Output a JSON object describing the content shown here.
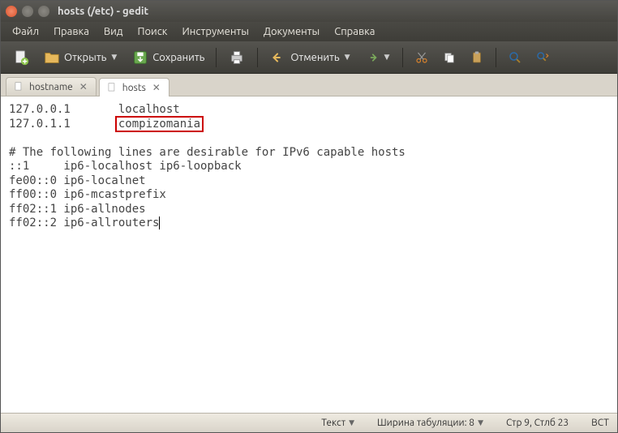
{
  "window": {
    "title": "hosts (/etc) - gedit"
  },
  "menu": {
    "file": "Файл",
    "edit": "Правка",
    "view": "Вид",
    "search": "Поиск",
    "tools": "Инструменты",
    "documents": "Документы",
    "help": "Справка"
  },
  "toolbar": {
    "open": "Открыть",
    "save": "Сохранить",
    "undo": "Отменить"
  },
  "tabs": [
    {
      "label": "hostname",
      "active": false
    },
    {
      "label": "hosts",
      "active": true
    }
  ],
  "editor": {
    "lines": [
      "127.0.0.1       localhost",
      "127.0.1.1       compizomania",
      "",
      "# The following lines are desirable for IPv6 capable hosts",
      "::1     ip6-localhost ip6-loopback",
      "fe00::0 ip6-localnet",
      "ff00::0 ip6-mcastprefix",
      "ff02::1 ip6-allnodes",
      "ff02::2 ip6-allrouters"
    ],
    "highlight": {
      "line": 1,
      "col_start": 16,
      "text": "compizomania"
    }
  },
  "status": {
    "syntax_label": "Текст",
    "tab_label": "Ширина табуляции: 8",
    "cursor": "Стр 9, Стлб 23",
    "mode": "ВСТ"
  }
}
